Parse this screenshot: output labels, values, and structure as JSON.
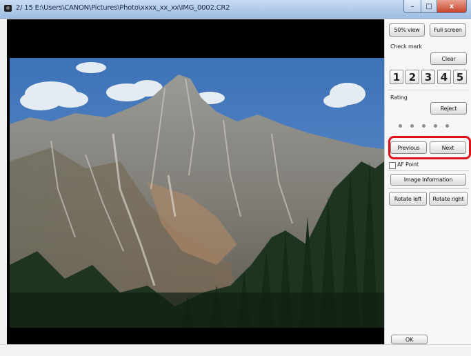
{
  "window": {
    "title": "2/ 15  E:\\Users\\CANON\\Pictures\\Photo\\xxxx_xx_xx\\IMG_0002.CR2",
    "caption_buttons": {
      "minimize": "–",
      "maximize": "□",
      "close": "x"
    }
  },
  "panel": {
    "view_50_label": "50% view",
    "full_screen_label": "Full screen",
    "check_mark_label": "Check mark",
    "clear_label": "Clear",
    "check_numbers": [
      "1",
      "2",
      "3",
      "4",
      "5"
    ],
    "rating_label": "Rating",
    "reject_label": "Reject",
    "previous_label": "Previous",
    "next_label": "Next",
    "af_point_label": "AF Point",
    "image_information_label": "Image Information",
    "rotate_left_label": "Rotate left",
    "rotate_right_label": "Rotate right",
    "ok_label": "OK"
  },
  "rating": {
    "value": 0,
    "max": 5
  },
  "af_point_checked": false,
  "photo": {
    "subject": "mountain-landscape-photo"
  },
  "colors": {
    "highlight": "#e0101a",
    "titlebar": "#b3cbea"
  }
}
